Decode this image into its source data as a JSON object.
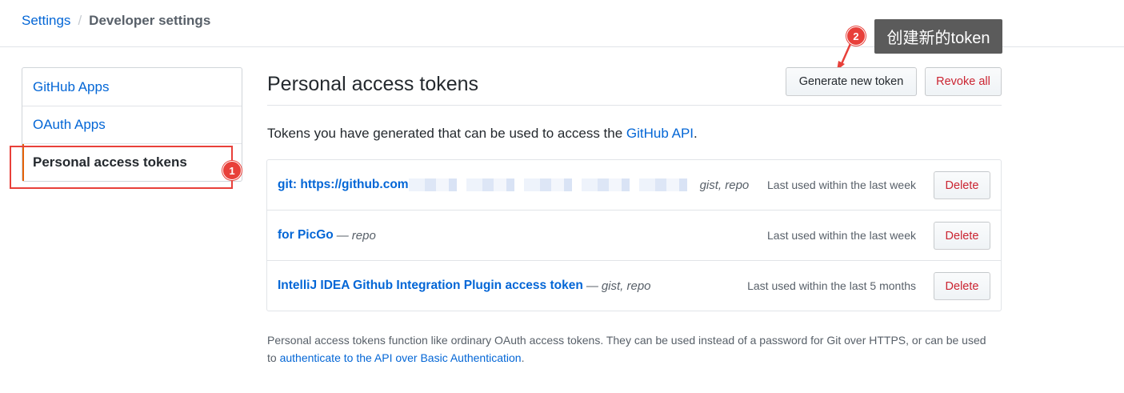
{
  "breadcrumb": {
    "settings": "Settings",
    "separator": "/",
    "current": "Developer settings"
  },
  "sidebar": {
    "items": [
      {
        "label": "GitHub Apps"
      },
      {
        "label": "OAuth Apps"
      },
      {
        "label": "Personal access tokens",
        "selected": true
      }
    ]
  },
  "annotations": {
    "badge_1": "1",
    "badge_2": "2",
    "tooltip": "创建新的token",
    "color": "#e8403a"
  },
  "main": {
    "title": "Personal access tokens",
    "generate_button": "Generate new token",
    "revoke_all_button": "Revoke all",
    "intro_text": "Tokens you have generated that can be used to access the ",
    "intro_link": "GitHub API",
    "intro_end": ".",
    "tokens": [
      {
        "name": "git: https://github.com",
        "scopes_sep": "",
        "scopes": "gist, repo",
        "last_used": "Last used within the last week",
        "delete": "Delete"
      },
      {
        "name": "for PicGo",
        "scopes_sep": "—",
        "scopes": "repo",
        "last_used": "Last used within the last week",
        "delete": "Delete"
      },
      {
        "name": "IntelliJ IDEA Github Integration Plugin access token",
        "scopes_sep": "—",
        "scopes": "gist, repo",
        "last_used": "Last used within the last 5 months",
        "delete": "Delete"
      }
    ],
    "footnote_text": "Personal access tokens function like ordinary OAuth access tokens. They can be used instead of a password for Git over HTTPS, or can be used to ",
    "footnote_link": "authenticate to the API over Basic Authentication",
    "footnote_end": "."
  },
  "colors": {
    "link": "#0366d6",
    "danger": "#cb2431",
    "selected_bar": "#e36209",
    "annotation": "#e8403a",
    "tooltip_bg": "#5b5b5b"
  }
}
